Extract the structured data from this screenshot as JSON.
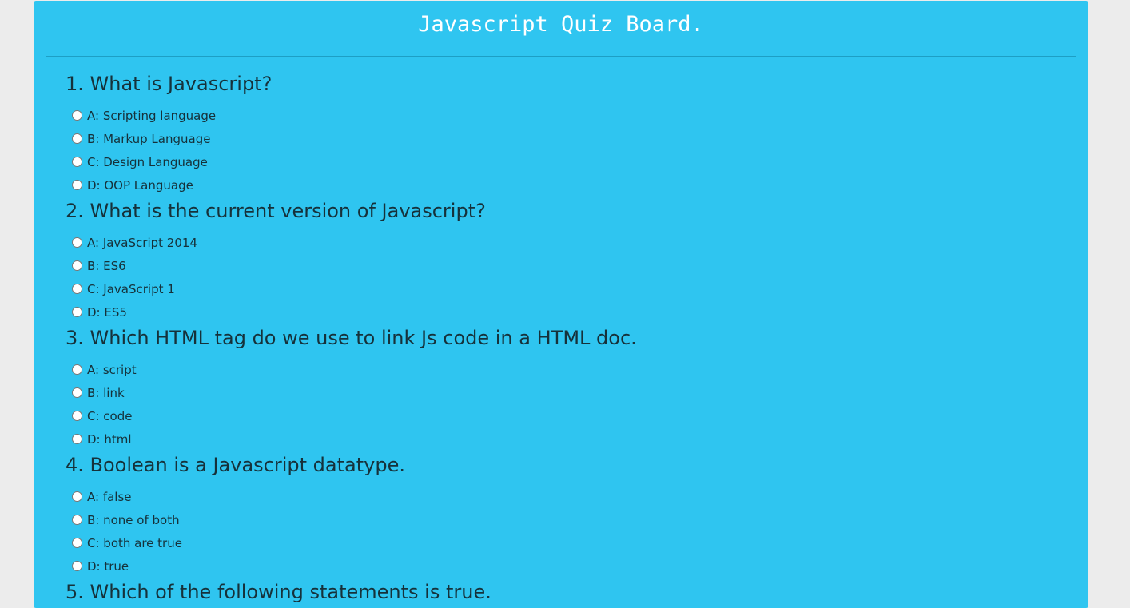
{
  "header": {
    "title": "Javascript Quiz Board."
  },
  "questions": [
    {
      "title": "1. What is Javascript?",
      "options": [
        "A: Scripting language",
        "B: Markup Language",
        "C: Design Language",
        "D: OOP Language"
      ]
    },
    {
      "title": "2. What is the current version of Javascript?",
      "options": [
        "A: JavaScript 2014",
        "B: ES6",
        "C: JavaScript 1",
        "D: ES5"
      ]
    },
    {
      "title": "3. Which HTML tag do we use to link Js code in a HTML doc.",
      "options": [
        "A: script",
        "B: link",
        "C: code",
        "D: html"
      ]
    },
    {
      "title": "4. Boolean is a Javascript datatype.",
      "options": [
        "A: false",
        "B: none of both",
        "C: both are true",
        "D: true"
      ]
    },
    {
      "title": "5. Which of the following statements is true.",
      "options": []
    }
  ]
}
